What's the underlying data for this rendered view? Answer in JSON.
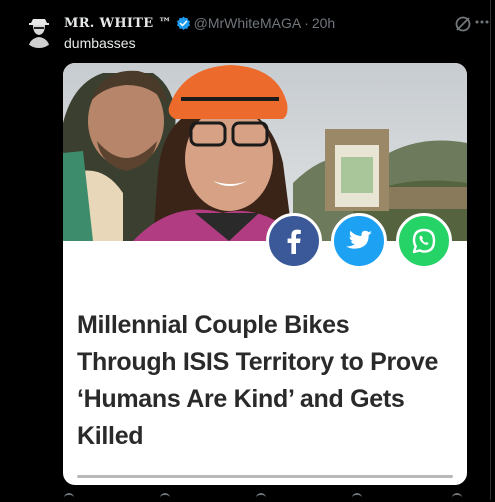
{
  "tweet": {
    "display_name": "MR. WHITE ™",
    "handle": "@MrWhiteMAGA",
    "separator": "·",
    "time": "20h",
    "text": "dumbasses"
  },
  "card": {
    "headline": "Millennial Couple Bikes Through ISIS Territory to Prove ‘Humans Are Kind’ and Gets Killed",
    "share_buttons": [
      "facebook",
      "twitter",
      "whatsapp"
    ]
  },
  "colors": {
    "verified": "#1d9bf0",
    "facebook": "#3b5998",
    "twitter": "#1da1f2",
    "whatsapp": "#25d366",
    "muted": "#71767b"
  },
  "icons": [
    "avatar",
    "verified-badge-icon",
    "grok-icon",
    "more-icon",
    "facebook-icon",
    "twitter-icon",
    "whatsapp-icon"
  ]
}
